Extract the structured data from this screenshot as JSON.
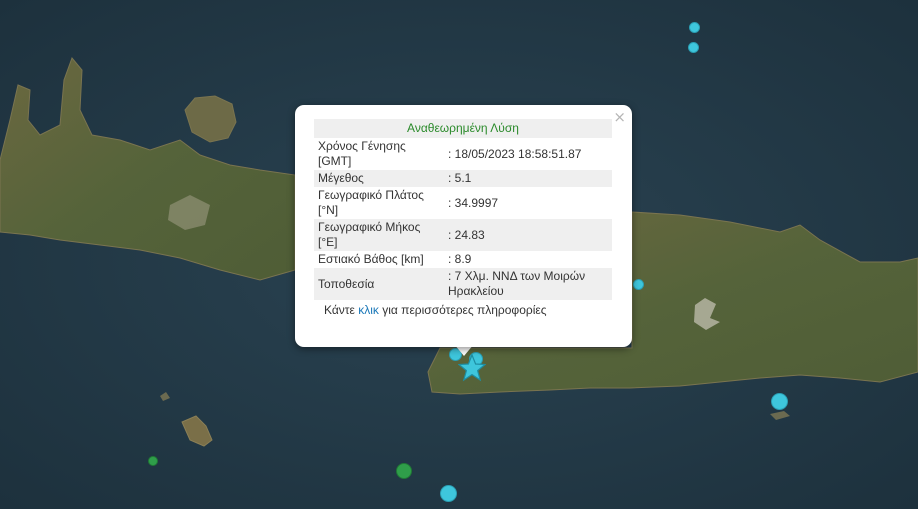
{
  "popup": {
    "header": "Αναθεωρημένη Λύση",
    "close_symbol": "×",
    "rows": [
      {
        "label": "Χρόνος Γένησης [GMT]",
        "value": ": 18/05/2023 18:58:51.87"
      },
      {
        "label": "Μέγεθος",
        "value": ": 5.1"
      },
      {
        "label": "Γεωγραφικό Πλάτος [°N]",
        "value": ": 34.9997"
      },
      {
        "label": "Γεωγραφικό Μήκος [°E]",
        "value": ": 24.83"
      },
      {
        "label": "Εστιακό Βάθος [km]",
        "value": ": 8.9"
      },
      {
        "label": "Τοποθεσία",
        "value": ": 7 Χλμ. ΝΝΔ των Μοιρών Ηρακλείου"
      }
    ],
    "footer_pre": "Κάντε ",
    "footer_link": "κλικ",
    "footer_post": " για περισσότερες πληροφορίες"
  },
  "colors": {
    "sea": "#243a47",
    "land": "#5f6b3c",
    "marker_recent": "#3ec6dc",
    "marker_old": "#2f9e4a"
  },
  "markers": [
    {
      "id": "main-event",
      "icon": "star-icon",
      "color": "#3ec6dc"
    }
  ]
}
